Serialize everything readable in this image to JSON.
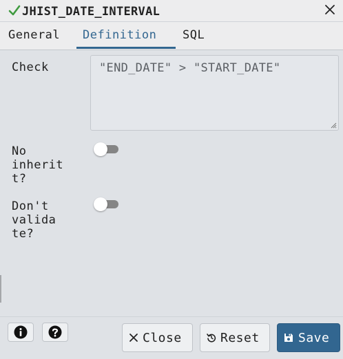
{
  "dialog": {
    "title": "JHIST_DATE_INTERVAL",
    "title_icon": "check-icon",
    "close_icon": "close-icon"
  },
  "tabs": [
    {
      "label": "General",
      "active": false
    },
    {
      "label": "Definition",
      "active": true
    },
    {
      "label": "SQL",
      "active": false
    }
  ],
  "form": {
    "check_label": "Check",
    "check_value": "\"END_DATE\" > \"START_DATE\"",
    "no_inherit_label": [
      "No",
      "inherit",
      "t?"
    ],
    "no_inherit_value": false,
    "dont_validate_label": [
      "Don't",
      "valida",
      "te?"
    ],
    "dont_validate_value": false
  },
  "footer": {
    "info_icon": "info-icon",
    "help_icon": "help-icon",
    "close_label": "Close",
    "reset_label": "Reset",
    "save_label": "Save"
  },
  "colors": {
    "accent": "#326690",
    "check_green": "#3f9a3f",
    "toggle_off": "#858585"
  }
}
